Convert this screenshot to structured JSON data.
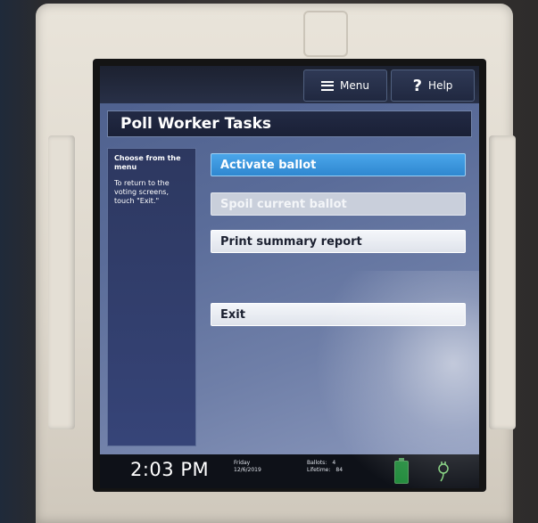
{
  "toolbar": {
    "menu_label": "Menu",
    "help_glyph": "?",
    "help_label": "Help"
  },
  "page": {
    "title": "Poll Worker Tasks"
  },
  "instructions": {
    "heading": "Choose from the menu",
    "body": "To return to the voting screens, touch \"Exit.\""
  },
  "actions": {
    "activate_ballot": "Activate ballot",
    "spoil_current_ballot": "Spoil current ballot",
    "print_summary_report": "Print summary report",
    "exit": "Exit"
  },
  "status": {
    "time": "2:03 PM",
    "day": "Friday",
    "date": "12/6/2019",
    "ballots_label": "Ballots:",
    "ballots_value": "4",
    "lifetime_label": "Lifetime:",
    "lifetime_value": "84"
  },
  "icons": {
    "menu": "hamburger-icon",
    "help": "question-mark-icon",
    "battery": "battery-icon",
    "power": "power-plug-icon"
  },
  "colors": {
    "activate_button": "#3b97dd",
    "title_bar": "#1e2540",
    "battery": "#1f8a3a"
  }
}
